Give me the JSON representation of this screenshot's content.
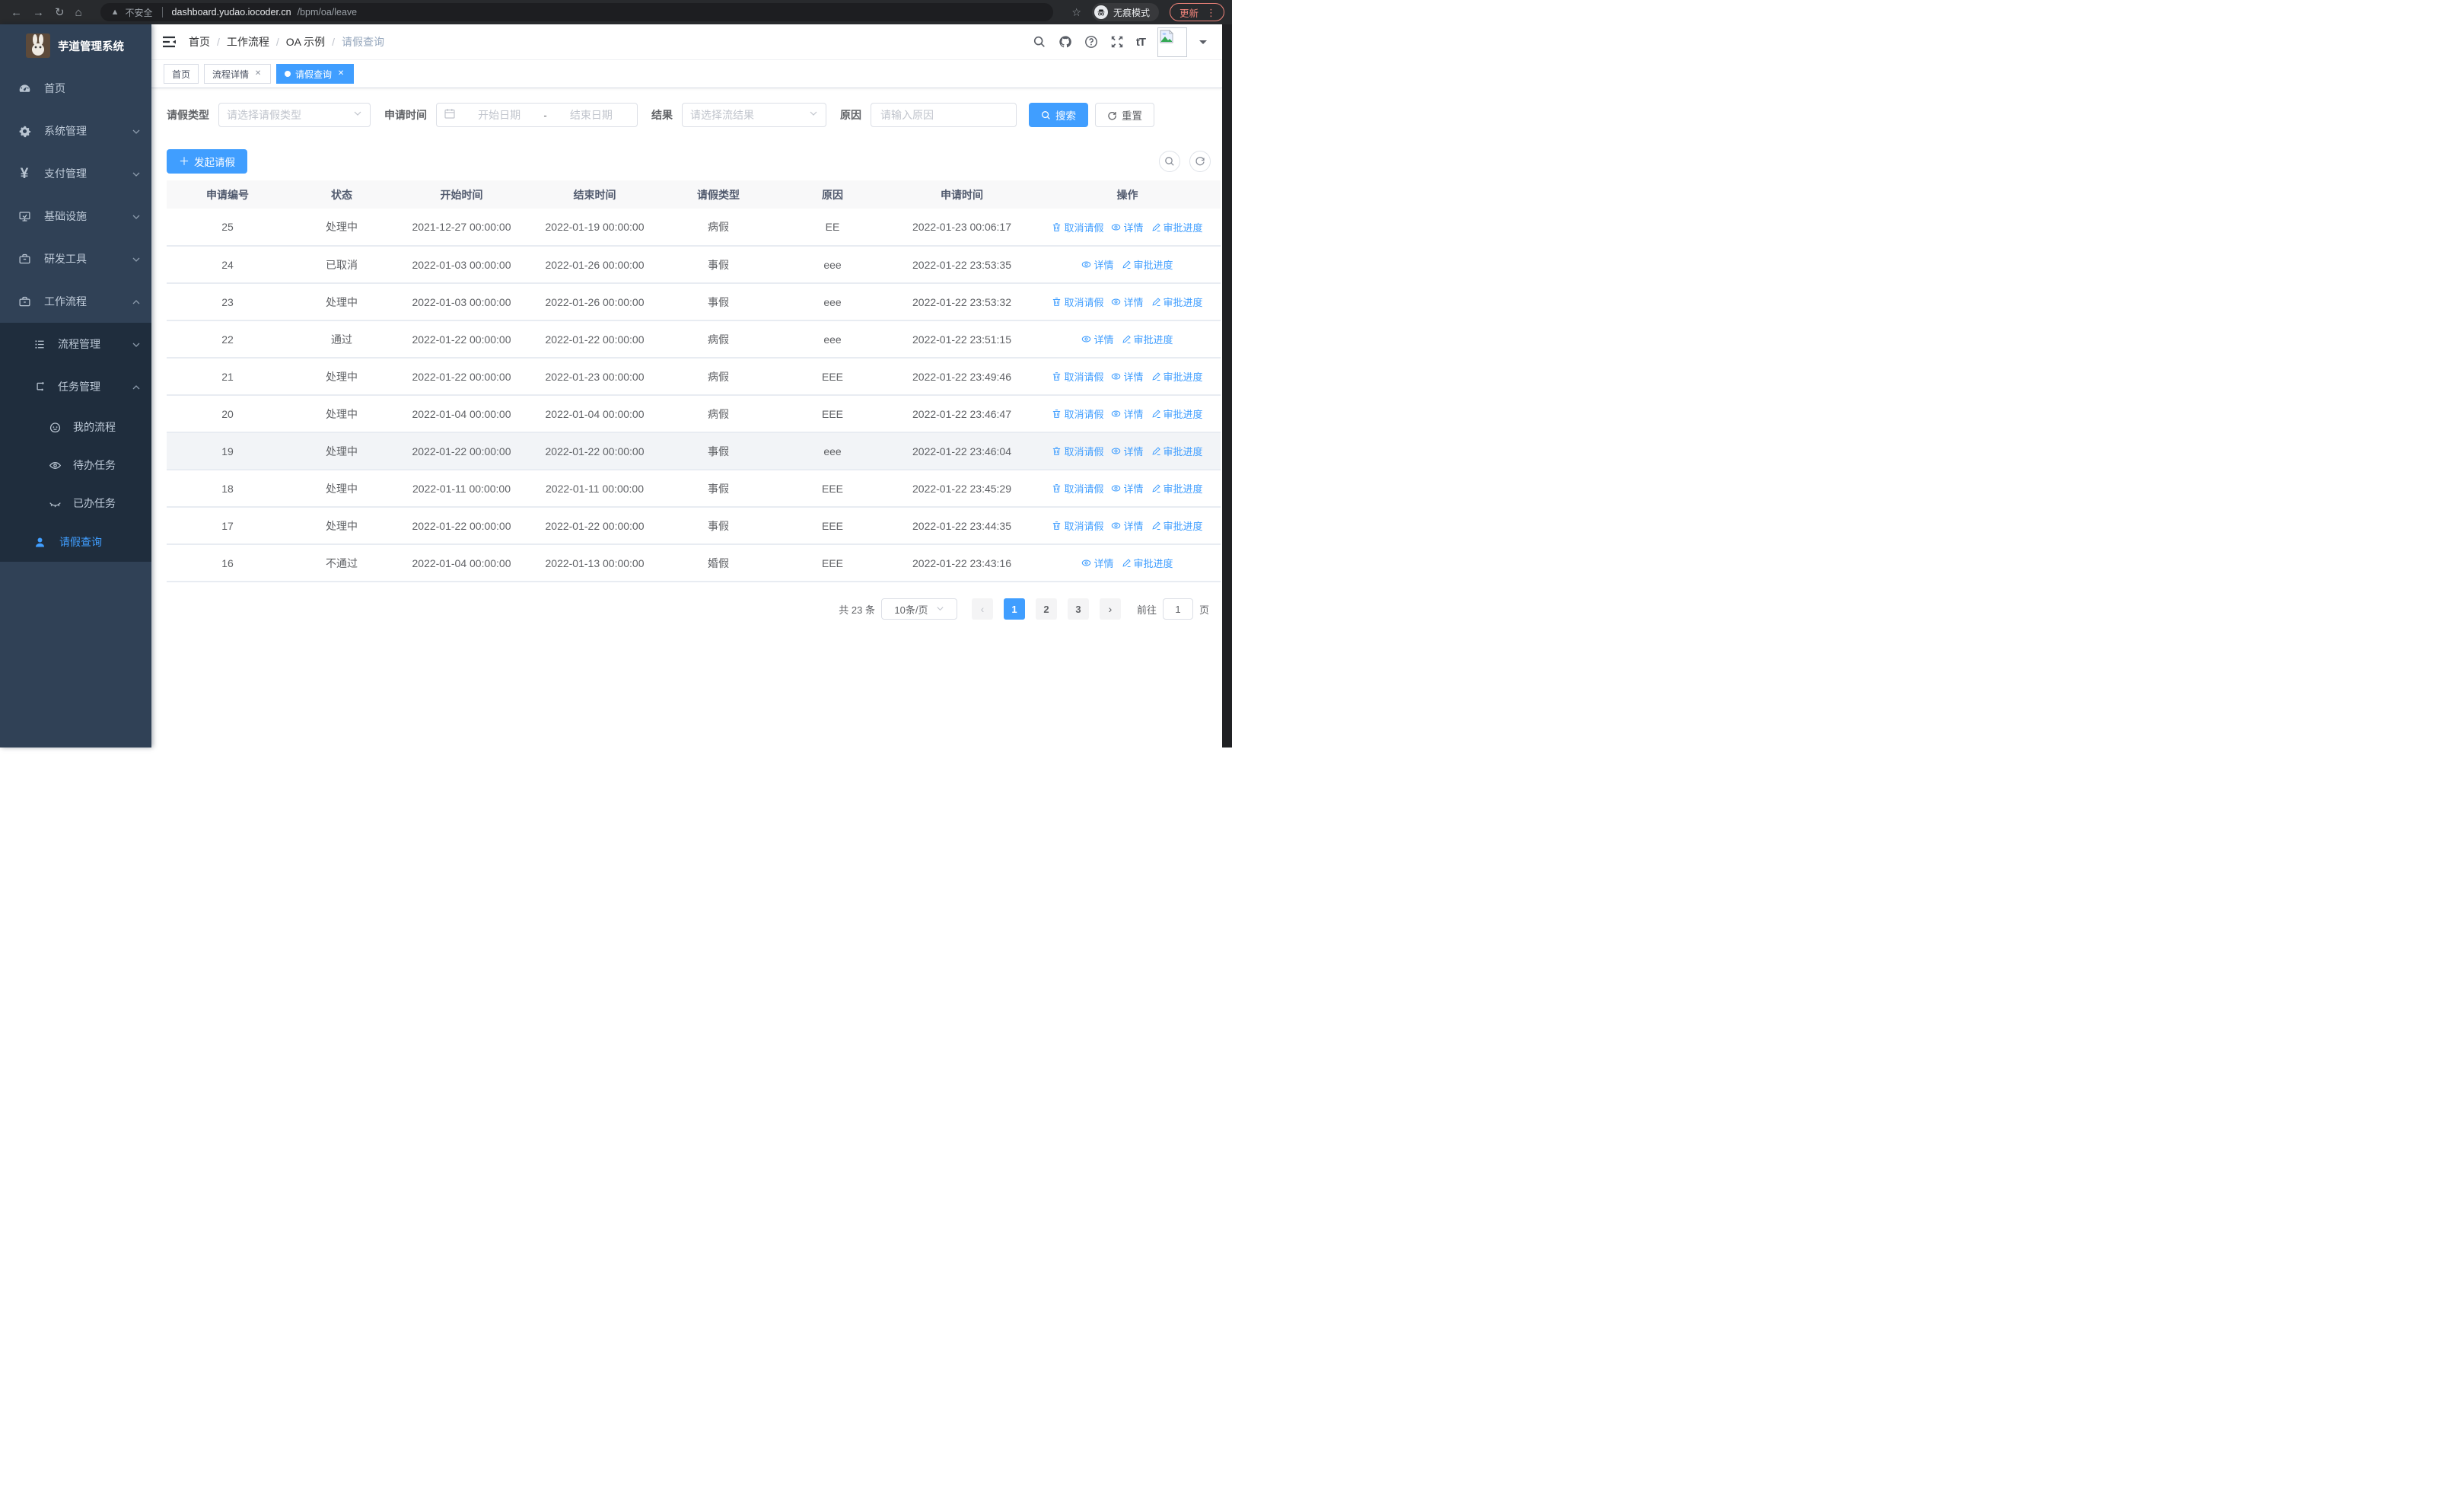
{
  "browser": {
    "security_label": "不安全",
    "url_host": "dashboard.yudao.iocoder.cn",
    "url_path": "/bpm/oa/leave",
    "incognito_label": "无痕模式",
    "update_label": "更新"
  },
  "app": {
    "title": "芋道管理系统"
  },
  "sidebar": {
    "items": [
      {
        "label": "首页",
        "icon": "dashboard-icon"
      },
      {
        "label": "系统管理",
        "icon": "gear-icon"
      },
      {
        "label": "支付管理",
        "icon": "yen-icon"
      },
      {
        "label": "基础设施",
        "icon": "infrastructure-icon"
      },
      {
        "label": "研发工具",
        "icon": "toolbox-icon"
      },
      {
        "label": "工作流程",
        "icon": "workflow-icon"
      }
    ],
    "submenu": {
      "process_mgmt": {
        "label": "流程管理"
      },
      "task_mgmt": {
        "label": "任务管理"
      },
      "task_children": [
        {
          "label": "我的流程",
          "icon": "face-icon"
        },
        {
          "label": "待办任务",
          "icon": "eye-icon"
        },
        {
          "label": "已办任务",
          "icon": "eye-closed-icon"
        }
      ],
      "leave_query": {
        "label": "请假查询"
      }
    }
  },
  "header": {
    "breadcrumb": [
      "首页",
      "工作流程",
      "OA 示例",
      "请假查询"
    ]
  },
  "tabs": [
    {
      "label": "首页"
    },
    {
      "label": "流程详情"
    },
    {
      "label": "请假查询"
    }
  ],
  "filters": {
    "leave_type_label": "请假类型",
    "leave_type_placeholder": "请选择请假类型",
    "apply_time_label": "申请时间",
    "date_start_placeholder": "开始日期",
    "date_separator": "-",
    "date_end_placeholder": "结束日期",
    "result_label": "结果",
    "result_placeholder": "请选择流结果",
    "reason_label": "原因",
    "reason_placeholder": "请输入原因",
    "search_label": "搜索",
    "reset_label": "重置"
  },
  "toolbar": {
    "create_label": "发起请假"
  },
  "table": {
    "columns": [
      "申请编号",
      "状态",
      "开始时间",
      "结束时间",
      "请假类型",
      "原因",
      "申请时间",
      "操作"
    ],
    "action_labels": {
      "cancel": "取消请假",
      "detail": "详情",
      "progress": "审批进度"
    },
    "rows": [
      {
        "id": "25",
        "status": "处理中",
        "start": "2021-12-27 00:00:00",
        "end": "2022-01-19 00:00:00",
        "type": "病假",
        "reason": "EE",
        "applied": "2022-01-23 00:06:17",
        "actions": [
          "cancel",
          "detail",
          "progress"
        ],
        "highlight": false
      },
      {
        "id": "24",
        "status": "已取消",
        "start": "2022-01-03 00:00:00",
        "end": "2022-01-26 00:00:00",
        "type": "事假",
        "reason": "eee",
        "applied": "2022-01-22 23:53:35",
        "actions": [
          "detail",
          "progress"
        ],
        "highlight": false
      },
      {
        "id": "23",
        "status": "处理中",
        "start": "2022-01-03 00:00:00",
        "end": "2022-01-26 00:00:00",
        "type": "事假",
        "reason": "eee",
        "applied": "2022-01-22 23:53:32",
        "actions": [
          "cancel",
          "detail",
          "progress"
        ],
        "highlight": false
      },
      {
        "id": "22",
        "status": "通过",
        "start": "2022-01-22 00:00:00",
        "end": "2022-01-22 00:00:00",
        "type": "病假",
        "reason": "eee",
        "applied": "2022-01-22 23:51:15",
        "actions": [
          "detail",
          "progress"
        ],
        "highlight": false
      },
      {
        "id": "21",
        "status": "处理中",
        "start": "2022-01-22 00:00:00",
        "end": "2022-01-23 00:00:00",
        "type": "病假",
        "reason": "EEE",
        "applied": "2022-01-22 23:49:46",
        "actions": [
          "cancel",
          "detail",
          "progress"
        ],
        "highlight": false
      },
      {
        "id": "20",
        "status": "处理中",
        "start": "2022-01-04 00:00:00",
        "end": "2022-01-04 00:00:00",
        "type": "病假",
        "reason": "EEE",
        "applied": "2022-01-22 23:46:47",
        "actions": [
          "cancel",
          "detail",
          "progress"
        ],
        "highlight": false
      },
      {
        "id": "19",
        "status": "处理中",
        "start": "2022-01-22 00:00:00",
        "end": "2022-01-22 00:00:00",
        "type": "事假",
        "reason": "eee",
        "applied": "2022-01-22 23:46:04",
        "actions": [
          "cancel",
          "detail",
          "progress"
        ],
        "highlight": true
      },
      {
        "id": "18",
        "status": "处理中",
        "start": "2022-01-11 00:00:00",
        "end": "2022-01-11 00:00:00",
        "type": "事假",
        "reason": "EEE",
        "applied": "2022-01-22 23:45:29",
        "actions": [
          "cancel",
          "detail",
          "progress"
        ],
        "highlight": false
      },
      {
        "id": "17",
        "status": "处理中",
        "start": "2022-01-22 00:00:00",
        "end": "2022-01-22 00:00:00",
        "type": "事假",
        "reason": "EEE",
        "applied": "2022-01-22 23:44:35",
        "actions": [
          "cancel",
          "detail",
          "progress"
        ],
        "highlight": false
      },
      {
        "id": "16",
        "status": "不通过",
        "start": "2022-01-04 00:00:00",
        "end": "2022-01-13 00:00:00",
        "type": "婚假",
        "reason": "EEE",
        "applied": "2022-01-22 23:43:16",
        "actions": [
          "detail",
          "progress"
        ],
        "highlight": false
      }
    ]
  },
  "pagination": {
    "total_label": "共 23 条",
    "page_size_label": "10条/页",
    "pages": [
      "1",
      "2",
      "3"
    ],
    "active_page": "1",
    "goto_label": "前往",
    "goto_value": "1",
    "page_unit": "页"
  },
  "colors": {
    "accent": "#409eff",
    "sidebar_bg": "#304156",
    "submenu_bg": "#1f2d3d",
    "update_badge": "#ee8379"
  }
}
